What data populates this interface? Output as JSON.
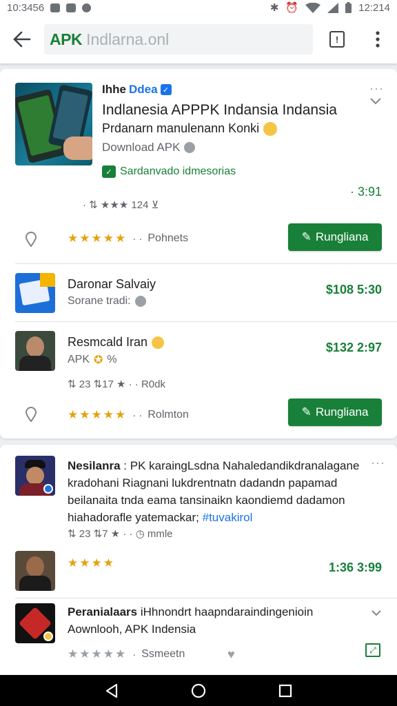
{
  "status_bar": {
    "time_left": "10:3456",
    "time_right": "12:214"
  },
  "address_bar": {
    "brand": "APK",
    "text": "Indlarna.onl"
  },
  "featured": {
    "heading": "Ihhe",
    "badge_text": "Ddea",
    "title": "Indlanesia APPPK Indansia Indansia",
    "subtitle": "Prdanarn manulenann Konki",
    "source": "Download APK",
    "verified": "Sardanvado idmesorias",
    "price": "· 3:91",
    "meta": "· ⇅ ★★★ 124 ⊻",
    "rating_text": "Pohnets",
    "button": "Rungliana"
  },
  "item2": {
    "title": "Daronar Salvaiy",
    "subtitle": "Sorane tradi:",
    "price": "$108 5:30"
  },
  "item3": {
    "title": "Resmcald Iran",
    "subtitle": "APK",
    "subtitle_extra": "%",
    "meta": "⇅ 23 ⇅17 ★ · · R0dk",
    "price": "$132 2:97",
    "rating_text": "Rolmton",
    "button": "Rungliana"
  },
  "post1": {
    "author": "Nesilanra",
    "text": ": PK karaingLsdna Nahaledandikdranalagane kradohani Riagnani lukdrentnatn dadandn papamad beilanaita tnda eama tansinaikn kaondiemd dadamon hiahadorafle yatemackar;",
    "hashtag": "#tuvakirol",
    "meta": "⇅ 23 ⇅7 ★ · · ◷ mmle"
  },
  "post2": {
    "price": "1:36 3:99"
  },
  "post3": {
    "author": "Peranialaars",
    "text": "iHhnondrt haapndaraindingenioin Aownlooh, APK Indensia",
    "rating_text": "Ssmeetn"
  },
  "colors": {
    "brand_green": "#188038",
    "star_gold": "#e6a20c",
    "verified_blue": "#1a73e8"
  }
}
